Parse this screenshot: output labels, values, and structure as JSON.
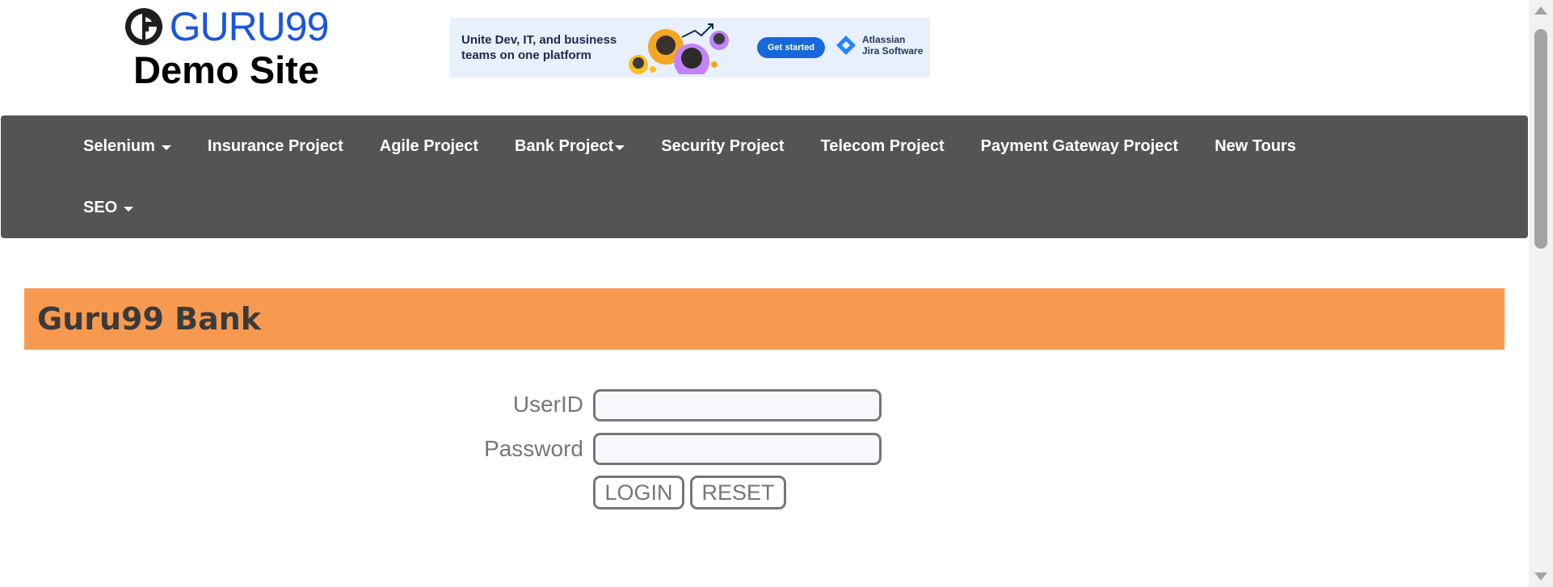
{
  "header": {
    "logo_text": "GURU99",
    "site_subtitle": "Demo Site"
  },
  "ad": {
    "headline": "Unite Dev, IT, and business teams on one platform",
    "cta_label": "Get started",
    "brand_line1": "Atlassian",
    "brand_line2": "Jira Software"
  },
  "nav": {
    "row1": [
      {
        "label": "Selenium",
        "dropdown": true
      },
      {
        "label": "Insurance Project",
        "dropdown": false
      },
      {
        "label": "Agile Project",
        "dropdown": false
      },
      {
        "label": "Bank Project",
        "dropdown": true
      },
      {
        "label": "Security Project",
        "dropdown": false
      },
      {
        "label": "Telecom Project",
        "dropdown": false
      },
      {
        "label": "Payment Gateway Project",
        "dropdown": false
      },
      {
        "label": "New Tours",
        "dropdown": false
      }
    ],
    "row2": [
      {
        "label": "SEO",
        "dropdown": true
      }
    ]
  },
  "bank": {
    "title": "Guru99 Bank"
  },
  "login_form": {
    "userid_label": "UserID",
    "userid_value": "",
    "password_label": "Password",
    "password_value": "",
    "login_button": "LOGIN",
    "reset_button": "RESET"
  },
  "colors": {
    "nav_bg": "#545454",
    "bank_bar": "#f79a50",
    "logo_blue": "#1a56db"
  }
}
